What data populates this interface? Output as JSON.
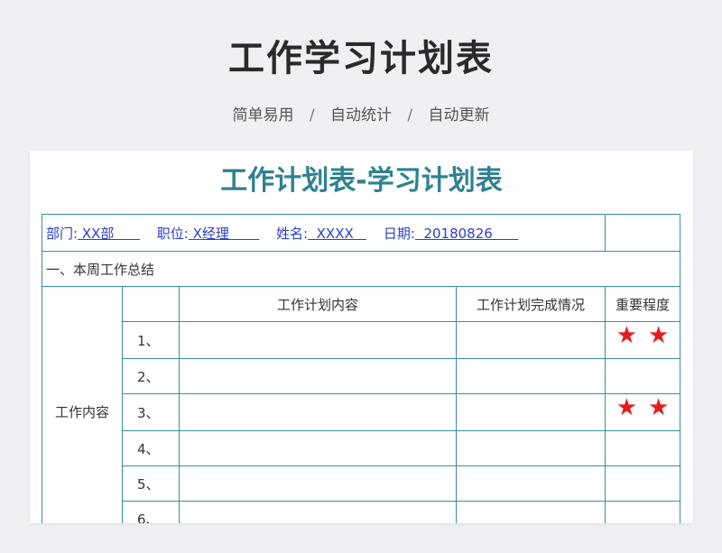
{
  "header": {
    "title": "工作学习计划表",
    "features": [
      "简单易用",
      "自动统计",
      "自动更新"
    ],
    "separator": "/"
  },
  "sheet": {
    "title": "工作计划表-学习计划表",
    "info": {
      "dept_label": "部门:",
      "dept_value": " XX部      ",
      "position_label": "职位:",
      "position_value": " X经理       ",
      "name_label": "姓名:",
      "name_value": "  XXXX   ",
      "date_label": "日期:",
      "date_value": "  20180826      "
    },
    "section_title": "一、本周工作总结",
    "columns": {
      "content": "工作计划内容",
      "status": "工作计划完成情况",
      "importance": "重要程度"
    },
    "row_group_label": "工作内容",
    "rows": [
      {
        "num": "1、",
        "stars": "★ ★"
      },
      {
        "num": "2、",
        "stars": ""
      },
      {
        "num": "3、",
        "stars": "★ ★"
      },
      {
        "num": "4、",
        "stars": ""
      },
      {
        "num": "5、",
        "stars": ""
      },
      {
        "num": "6、",
        "stars": ""
      }
    ],
    "star_color": "#e51c1c",
    "border_color": "#3a8ea0",
    "title_color": "#2f8291"
  }
}
